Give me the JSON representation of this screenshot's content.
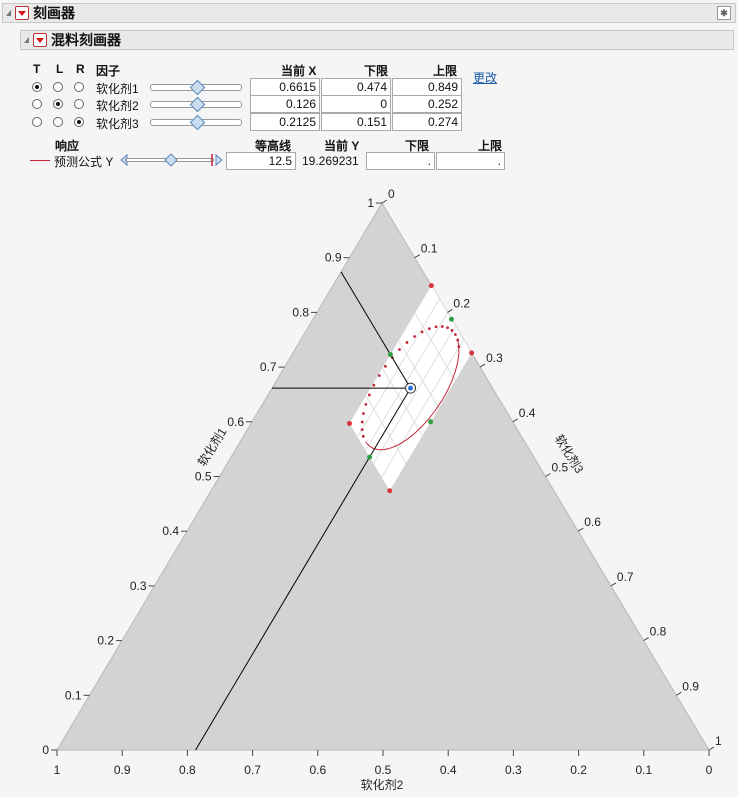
{
  "outline": {
    "title": "刻画器",
    "sub_title": "混料刻画器",
    "pin_icon": "pin-icon"
  },
  "factor_headers": {
    "t": "T",
    "l": "L",
    "r": "R",
    "factor": "因子",
    "current_x": "当前 X",
    "lower": "下限",
    "upper": "上限",
    "change_link": "更改"
  },
  "factors": [
    {
      "name": "软化剂1",
      "current_x": "0.6615",
      "lower": "0.474",
      "upper": "0.849",
      "selected_axis": "T",
      "slider_fraction": 0.6615
    },
    {
      "name": "软化剂2",
      "current_x": "0.126",
      "lower": "0",
      "upper": "0.252",
      "selected_axis": "L",
      "slider_fraction": 0.5
    },
    {
      "name": "软化剂3",
      "current_x": "0.2125",
      "lower": "0.151",
      "upper": "0.274",
      "selected_axis": "R",
      "slider_fraction": 0.5
    }
  ],
  "response_headers": {
    "response": "响应",
    "contour": "等高线",
    "current_y": "当前 Y",
    "lower": "下限",
    "upper": "上限"
  },
  "response": {
    "name": "预测公式 Y",
    "contour_value": "12.5",
    "current_y": "19.269231",
    "lower": ".",
    "upper": ".",
    "line_color": "#c0283c",
    "slider_fraction": 0.5
  },
  "ternary": {
    "top_axis_name": "软化剂1",
    "left_axis_name": "软化剂2",
    "right_axis_name": "软化剂3",
    "left_ticks": [
      "0",
      "0.1",
      "0.2",
      "0.3",
      "0.4",
      "0.5",
      "0.6",
      "0.7",
      "0.8",
      "0.9",
      "1"
    ],
    "bottom_ticks": [
      "1",
      "0.9",
      "0.8",
      "0.7",
      "0.6",
      "0.5",
      "0.4",
      "0.3",
      "0.2",
      "0.1",
      "0"
    ],
    "right_ticks": [
      "0",
      "0.1",
      "0.2",
      "0.3",
      "0.4",
      "0.5",
      "0.6",
      "0.7",
      "0.8",
      "0.9",
      "1"
    ],
    "current_point": {
      "x1": 0.6615,
      "x2": 0.126,
      "x3": 0.2125
    },
    "feasible_vertices": [
      {
        "x1": 0.849,
        "x2": 0.0,
        "x3": 0.151
      },
      {
        "x1": 0.726,
        "x2": 0.0,
        "x3": 0.274
      },
      {
        "x1": 0.474,
        "x2": 0.252,
        "x3": 0.274
      },
      {
        "x1": 0.597,
        "x2": 0.252,
        "x3": 0.151
      }
    ],
    "vertex_color": "#d9363e",
    "midpoint_color": "#2ea043",
    "shade_color": "#d3d3d3",
    "feasible_color": "#ffffff",
    "contour_color": "#c0283c",
    "crosshair_color": "#000000",
    "current_marker_color": "#2f6fd6"
  }
}
